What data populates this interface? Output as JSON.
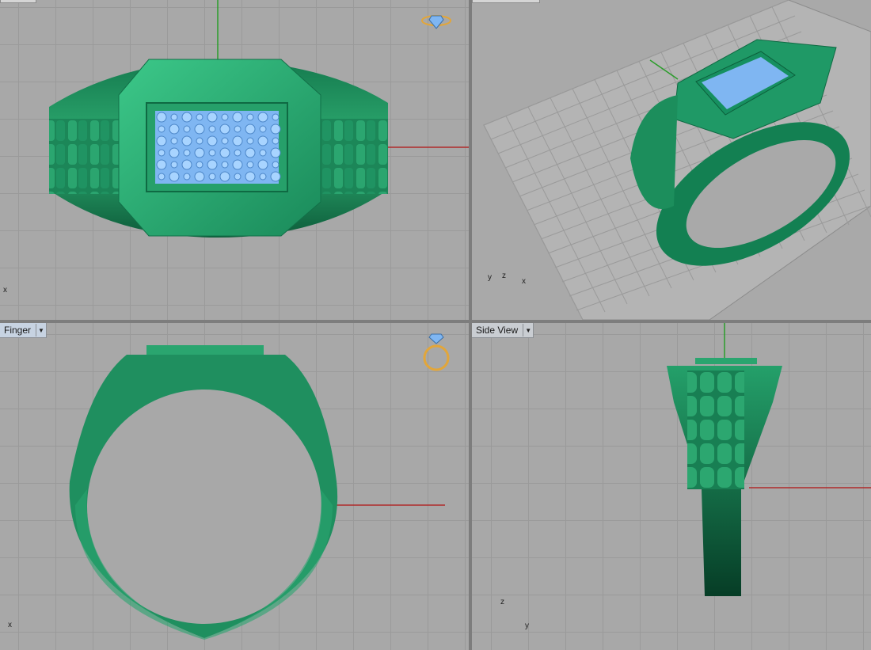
{
  "viewports": {
    "top": {
      "axes": {
        "x": "x"
      }
    },
    "perspective": {
      "axes": {
        "y": "y",
        "z": "z",
        "x": "x"
      }
    },
    "front": {
      "label": "Finger",
      "axes": {
        "x": "x"
      }
    },
    "side": {
      "label": "Side View",
      "axes": {
        "z": "z",
        "y": "y"
      }
    }
  },
  "icons": {
    "gem_icon": "gem-icon",
    "ring_icon": "ring-icon",
    "dropdown": "chevron-down-icon"
  },
  "colors": {
    "ring_green": "#1f8c5d",
    "gem_blue": "#7fb6f2",
    "axis_red": "#b02a2a",
    "axis_green": "#2a9d2a",
    "gold_icon": "#e2a63a"
  }
}
